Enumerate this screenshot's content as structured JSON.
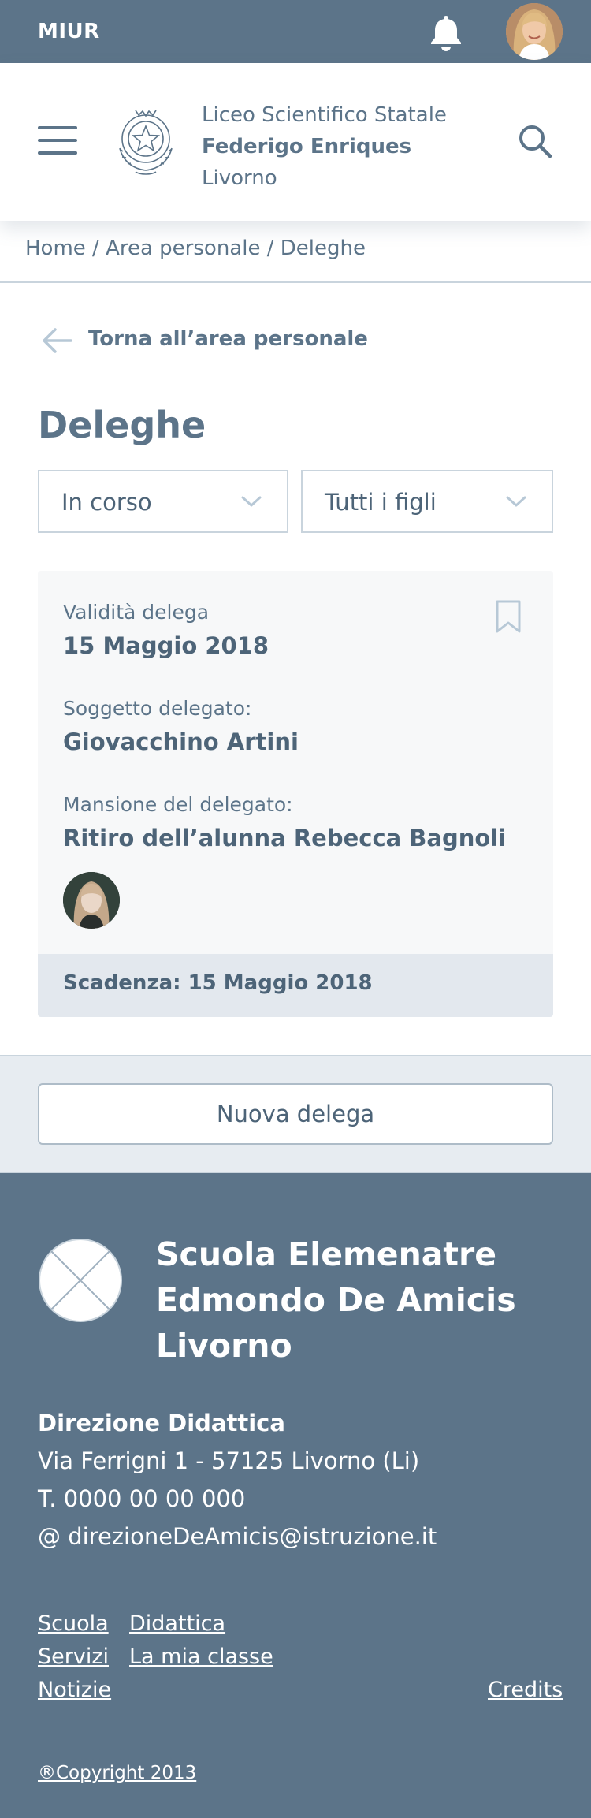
{
  "topbar": {
    "brand": "MIUR"
  },
  "header": {
    "school_line1": "Liceo Scientifico Statale",
    "school_line2": "Federigo Enriques",
    "school_line3": "Livorno"
  },
  "breadcrumb": {
    "items": [
      "Home",
      "Area personale",
      "Deleghe"
    ],
    "separator": " / "
  },
  "back_link": "Torna all’area personale",
  "page_title": "Deleghe",
  "filters": {
    "status": "In corso",
    "children": "Tutti i figli"
  },
  "delega": {
    "validity_label": "Validità delega",
    "validity_value": "15 Maggio 2018",
    "subject_label": "Soggetto delegato:",
    "subject_value": "Giovacchino Artini",
    "task_label": "Mansione del delegato:",
    "task_value": "Ritiro dell’alunna Rebecca Bagnoli",
    "expiry": "Scadenza: 15 Maggio 2018"
  },
  "new_delega_button": "Nuova delega",
  "footer": {
    "school_line1": "Scuola Elemenatre",
    "school_line2": "Edmondo De Amicis",
    "school_line3": "Livorno",
    "direction_heading": "Direzione Didattica",
    "address": "Via Ferrigni 1 - 57125 Livorno (Li)",
    "phone": "T. 0000 00 00 000",
    "email": "@ direzioneDeAmicis@istruzione.it",
    "links": {
      "scuola": "Scuola",
      "didattica": "Didattica",
      "servizi": "Servizi",
      "la_mia_classe": "La mia classe",
      "notizie": "Notizie",
      "credits": "Credits"
    },
    "copyright": "®Copyright 2013"
  },
  "colors": {
    "primary": "#5c7489",
    "card_bg": "#f7f8f9",
    "card_footer_bg": "#e3e8ee",
    "band_bg": "#e7ecf1"
  }
}
